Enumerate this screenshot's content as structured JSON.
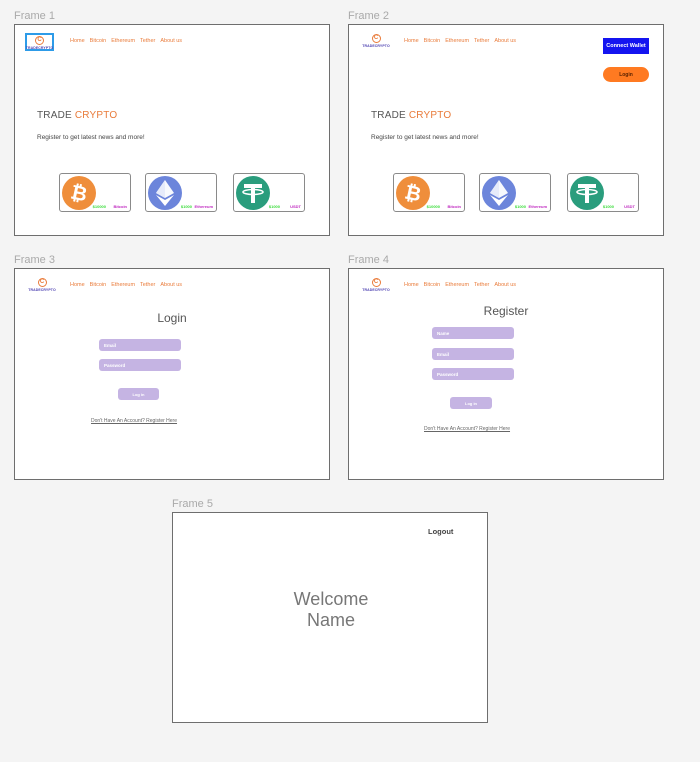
{
  "frames": {
    "f1_label": "Frame 1",
    "f2_label": "Frame 2",
    "f3_label": "Frame 3",
    "f4_label": "Frame 4",
    "f5_label": "Frame 5"
  },
  "logo": {
    "glyph": "C",
    "text": "TRADECRYPTO"
  },
  "nav": [
    "Home",
    "Bitcoin",
    "Ethereum",
    "Tether",
    "About us"
  ],
  "hero": {
    "title_plain": "TRADE ",
    "title_accent": "CRYPTO",
    "subtitle": "Register to get latest news and more!"
  },
  "cards": [
    {
      "price": "$10000",
      "name": "Bitcoin",
      "icon": "bitcoin-icon",
      "color": "#ef8e3b"
    },
    {
      "price": "$1000",
      "name": "Ethereum",
      "icon": "ethereum-icon",
      "color": "#6c85db"
    },
    {
      "price": "$1000",
      "name": "USDT",
      "icon": "tether-icon",
      "color": "#2a9d7d"
    }
  ],
  "frame2": {
    "connect_wallet": "Connect Wallet",
    "login": "Login"
  },
  "login_form": {
    "title": "Login",
    "email": "Email",
    "password": "Password",
    "submit": "Log in",
    "register_link": "Don't Have An Account? Register Here"
  },
  "register_form": {
    "title": "Register",
    "name": "Name",
    "email": "Email",
    "password": "Password",
    "submit": "Log in",
    "register_link": "Don't Have An Account? Register Here"
  },
  "frame5": {
    "logout": "Logout",
    "welcome_line1": "Welcome",
    "welcome_line2": "Name"
  },
  "colors": {
    "accent": "#e97b3a",
    "wallet_blue": "#1414f0",
    "login_orange": "#ff7a21",
    "field_purple": "#c5b4e3",
    "selection_blue": "#2d9be8"
  }
}
